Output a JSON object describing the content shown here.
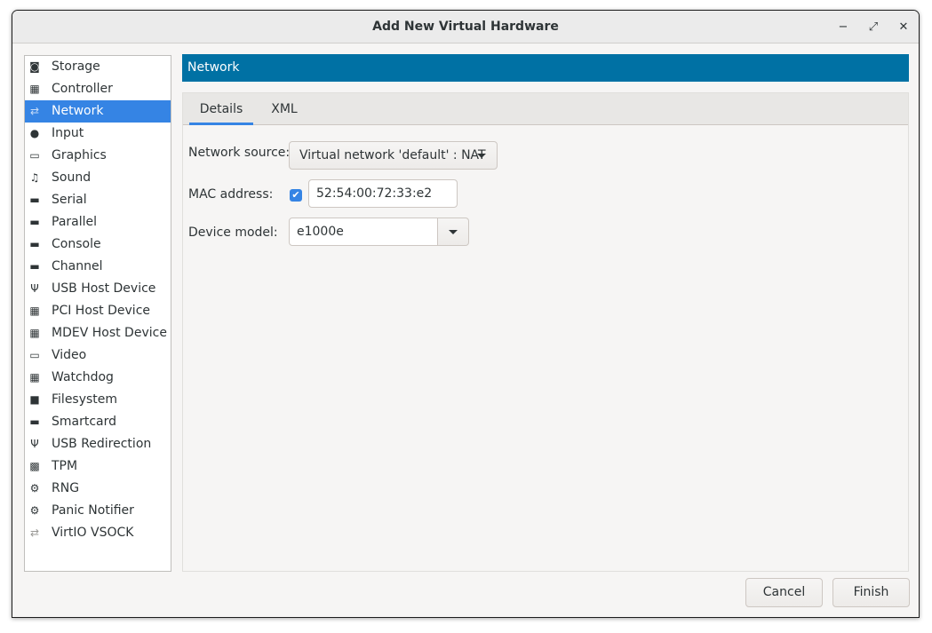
{
  "window": {
    "title": "Add New Virtual Hardware",
    "controls": {
      "minimize": "−",
      "maximize": "⤢",
      "close": "✕"
    }
  },
  "sidebar": {
    "selected": "Network",
    "items": [
      {
        "label": "Storage",
        "icon": "disk-icon"
      },
      {
        "label": "Controller",
        "icon": "chip-icon"
      },
      {
        "label": "Network",
        "icon": "network-icon"
      },
      {
        "label": "Input",
        "icon": "mouse-icon"
      },
      {
        "label": "Graphics",
        "icon": "monitor-icon"
      },
      {
        "label": "Sound",
        "icon": "music-icon"
      },
      {
        "label": "Serial",
        "icon": "port-icon"
      },
      {
        "label": "Parallel",
        "icon": "port-icon"
      },
      {
        "label": "Console",
        "icon": "port-icon"
      },
      {
        "label": "Channel",
        "icon": "port-icon"
      },
      {
        "label": "USB Host Device",
        "icon": "usb-icon"
      },
      {
        "label": "PCI Host Device",
        "icon": "chip-icon"
      },
      {
        "label": "MDEV Host Device",
        "icon": "chip-icon"
      },
      {
        "label": "Video",
        "icon": "monitor-icon"
      },
      {
        "label": "Watchdog",
        "icon": "chip-icon"
      },
      {
        "label": "Filesystem",
        "icon": "folder-icon"
      },
      {
        "label": "Smartcard",
        "icon": "port-icon"
      },
      {
        "label": "USB Redirection",
        "icon": "usb-icon"
      },
      {
        "label": "TPM",
        "icon": "tpm-icon"
      },
      {
        "label": "RNG",
        "icon": "gear-icon"
      },
      {
        "label": "Panic Notifier",
        "icon": "gear-icon"
      },
      {
        "label": "VirtIO VSOCK",
        "icon": "network-icon"
      }
    ]
  },
  "section": {
    "title": "Network"
  },
  "tabs": [
    {
      "label": "Details",
      "active": true
    },
    {
      "label": "XML",
      "active": false
    }
  ],
  "form": {
    "network_source": {
      "label": "Network source:",
      "value": "Virtual network 'default' : NAT"
    },
    "mac_address": {
      "label": "MAC address:",
      "checked": true,
      "value": "52:54:00:72:33:e2"
    },
    "device_model": {
      "label": "Device model:",
      "value": "e1000e"
    }
  },
  "buttons": {
    "cancel": "Cancel",
    "finish": "Finish"
  },
  "colors": {
    "accent": "#3584e4",
    "header": "#0071a4"
  }
}
